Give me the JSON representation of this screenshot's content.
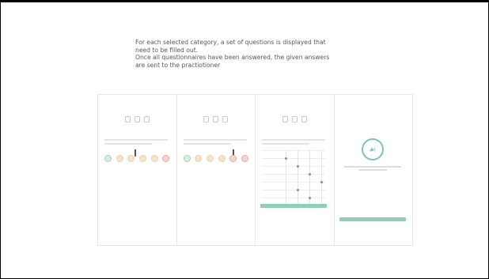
{
  "description": {
    "line1": "For each selected category, a set of questions is displayed that",
    "line2": "need to be filled out.",
    "line3": "Once all questionnaires have been answered, the given answers",
    "line4": "are sent to the practiotioner"
  },
  "colors": {
    "accent": "#8fcfb3",
    "text": "#575757",
    "border": "#e6e6e6"
  },
  "icons": {
    "final_logo": "practitioner-logo-icon"
  }
}
